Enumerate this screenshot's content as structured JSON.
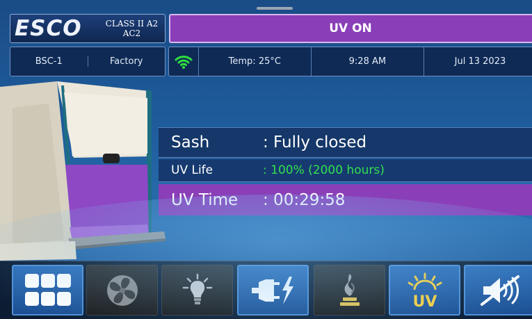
{
  "header": {
    "brand": "ESCO",
    "cabinet_class_line1": "CLASS II A2",
    "cabinet_class_line2": "AC2",
    "status_banner": "UV ON"
  },
  "info_bar": {
    "cabinet_id": "BSC-1",
    "user": "Factory",
    "wifi": "wifi-icon",
    "temperature": "Temp: 25°C",
    "time": "9:28 AM",
    "date": "Jul 13 2023"
  },
  "status": {
    "sash_label": "Sash",
    "sash_value": ": Fully closed",
    "uv_life_label": "UV Life",
    "uv_life_value": ": 100% (2000 hours)",
    "uv_time_label": "UV Time",
    "uv_time_value": ": 00:29:58"
  },
  "toolbar": {
    "buttons": [
      {
        "icon": "menu-grid-icon",
        "state": "active"
      },
      {
        "icon": "fan-icon",
        "state": "inactive"
      },
      {
        "icon": "lamp-icon",
        "state": "inactive"
      },
      {
        "icon": "power-outlet-icon",
        "state": "active"
      },
      {
        "icon": "gas-burner-icon",
        "state": "inactive"
      },
      {
        "icon": "uv-lamp-icon",
        "state": "active",
        "text": "UV"
      },
      {
        "icon": "alarm-mute-icon",
        "state": "active"
      }
    ]
  },
  "colors": {
    "uv_banner": "#8a3fb8",
    "uv_life_green": "#33e04f",
    "wifi_green": "#2fe03f",
    "active_button": "#2d6eb8"
  }
}
